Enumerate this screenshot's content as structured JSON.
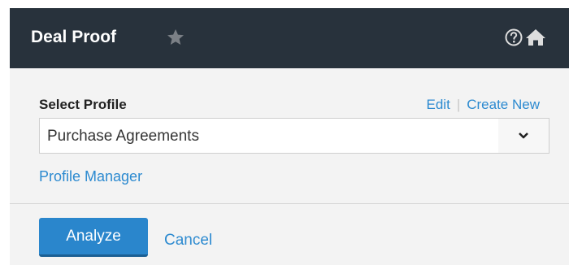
{
  "header": {
    "title": "Deal Proof",
    "icons": [
      "star-icon",
      "help-icon",
      "home-icon"
    ],
    "star_color": "#7b8086",
    "icon_color": "#dddddd",
    "background": "#28323c"
  },
  "profile": {
    "label": "Select Profile",
    "edit_link": "Edit",
    "separator": "|",
    "create_new_link": "Create New",
    "selected_value": "Purchase Agreements",
    "manager_link": "Profile Manager"
  },
  "actions": {
    "analyze_label": "Analyze",
    "cancel_label": "Cancel"
  },
  "colors": {
    "accent": "#2a86cc",
    "link": "#2c8ad0",
    "panel_bg": "#f3f3f3"
  }
}
